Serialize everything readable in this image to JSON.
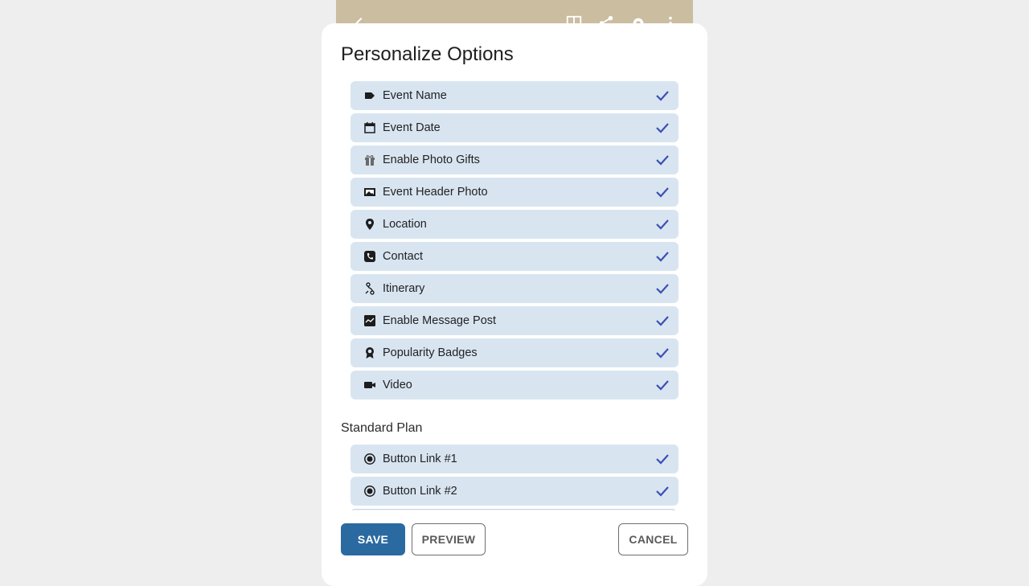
{
  "dialog": {
    "title": "Personalize Options",
    "options": [
      {
        "label": "Event Name",
        "icon": "label-icon",
        "checked": true
      },
      {
        "label": "Event Date",
        "icon": "calendar-icon",
        "checked": true
      },
      {
        "label": "Enable Photo Gifts",
        "icon": "gift-icon",
        "checked": true
      },
      {
        "label": "Event Header Photo",
        "icon": "photo-icon",
        "checked": true
      },
      {
        "label": "Location",
        "icon": "location-pin-icon",
        "checked": true
      },
      {
        "label": "Contact",
        "icon": "phone-icon",
        "checked": true
      },
      {
        "label": "Itinerary",
        "icon": "route-icon",
        "checked": true
      },
      {
        "label": "Enable Message Post",
        "icon": "message-post-icon",
        "checked": true
      },
      {
        "label": "Popularity Badges",
        "icon": "badge-icon",
        "checked": true
      },
      {
        "label": "Video",
        "icon": "video-camera-icon",
        "checked": true
      }
    ],
    "section": {
      "title": "Standard Plan",
      "options": [
        {
          "label": "Button Link #1",
          "icon": "radio-button-icon",
          "checked": true
        },
        {
          "label": "Button Link #2",
          "icon": "radio-button-icon",
          "checked": true
        }
      ]
    },
    "buttons": {
      "save": "SAVE",
      "preview": "PREVIEW",
      "cancel": "CANCEL"
    }
  },
  "colors": {
    "option_bg": "#d8e5f1",
    "check": "#3d4fb4",
    "save_bg": "#2b6aa0",
    "header_bg": "#cbbd9f"
  }
}
